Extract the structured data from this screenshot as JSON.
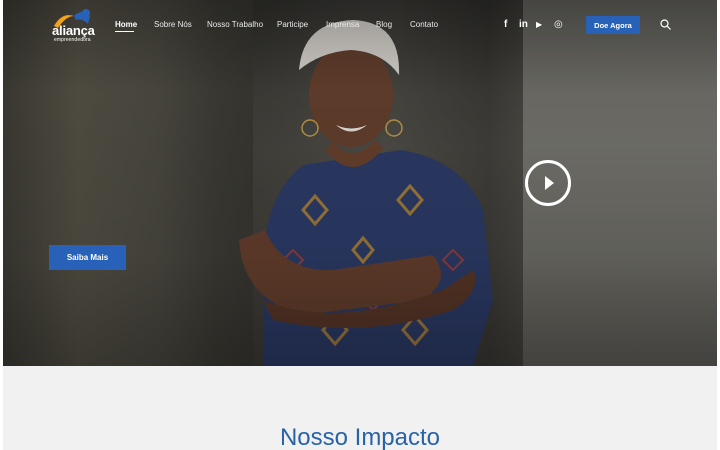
{
  "brand": {
    "name": "aliança",
    "tagline": "empreendedora",
    "colors": {
      "orange": "#f2a31b",
      "blue": "#2861b8",
      "navy": "#1e4f96"
    }
  },
  "nav": {
    "items": [
      {
        "label": "Home",
        "active": true
      },
      {
        "label": "Sobre Nós",
        "active": false
      },
      {
        "label": "Nosso Trabalho",
        "active": false
      },
      {
        "label": "Participe",
        "active": false
      },
      {
        "label": "Imprensa",
        "active": false
      },
      {
        "label": "Blog",
        "active": false
      },
      {
        "label": "Contato",
        "active": false
      }
    ]
  },
  "social": [
    {
      "icon": "facebook-icon",
      "glyph": "f"
    },
    {
      "icon": "linkedin-icon",
      "glyph": "in"
    },
    {
      "icon": "youtube-icon",
      "glyph": "▶"
    },
    {
      "icon": "instagram-icon",
      "glyph": "◎"
    }
  ],
  "header": {
    "donate_label": "Doe Agora"
  },
  "hero": {
    "cta_label": "Saiba Mais",
    "play_icon": "play-icon"
  },
  "impact": {
    "title": "Nosso Impacto"
  }
}
